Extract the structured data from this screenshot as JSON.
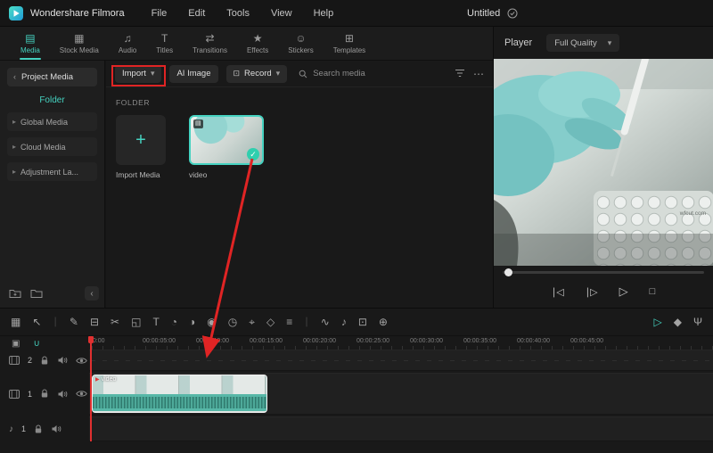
{
  "colors": {
    "accent": "#45d2c0",
    "annotation_red": "#e02424"
  },
  "titlebar": {
    "app_name": "Wondershare Filmora",
    "menus": [
      {
        "name": "menu-file",
        "label": "File"
      },
      {
        "name": "menu-edit",
        "label": "Edit"
      },
      {
        "name": "menu-tools",
        "label": "Tools"
      },
      {
        "name": "menu-view",
        "label": "View"
      },
      {
        "name": "menu-help",
        "label": "Help"
      }
    ],
    "project_name": "Untitled"
  },
  "tabs": [
    {
      "name": "tab-media",
      "label": "Media",
      "glyph": "▤",
      "active": true
    },
    {
      "name": "tab-stock-media",
      "label": "Stock Media",
      "glyph": "▦"
    },
    {
      "name": "tab-audio",
      "label": "Audio",
      "glyph": "♫"
    },
    {
      "name": "tab-titles",
      "label": "Titles",
      "glyph": "T"
    },
    {
      "name": "tab-transitions",
      "label": "Transitions",
      "glyph": "⇄"
    },
    {
      "name": "tab-effects",
      "label": "Effects",
      "glyph": "★"
    },
    {
      "name": "tab-stickers",
      "label": "Stickers",
      "glyph": "☺"
    },
    {
      "name": "tab-templates",
      "label": "Templates",
      "glyph": "⊞"
    }
  ],
  "sidebar": {
    "back_label": "Project Media",
    "selected_folder": "Folder",
    "groups": [
      {
        "name": "sidebar-item-global-media",
        "label": "Global Media"
      },
      {
        "name": "sidebar-item-cloud-media",
        "label": "Cloud Media"
      },
      {
        "name": "sidebar-item-adjustment-layer",
        "label": "Adjustment La..."
      }
    ]
  },
  "media_panel": {
    "toolbar": {
      "import_label": "Import",
      "ai_image_label": "AI Image",
      "record_label": "Record",
      "search_placeholder": "Search media"
    },
    "section_label": "FOLDER",
    "import_tile_label": "Import Media",
    "video_tile_label": "video"
  },
  "player": {
    "title": "Player",
    "quality": "Full Quality",
    "watermark": "wfcut.com",
    "transport": [
      {
        "name": "previous-frame-button",
        "glyph": "∣◁"
      },
      {
        "name": "next-frame-button",
        "glyph": "∣▷"
      },
      {
        "name": "play-button",
        "glyph": "▷",
        "big": true
      },
      {
        "name": "stop-button",
        "glyph": "□"
      }
    ]
  },
  "timeline": {
    "tools_left": [
      {
        "name": "media-browser-icon",
        "glyph": "▦"
      },
      {
        "name": "select-tool-icon",
        "glyph": "↖"
      },
      {
        "name": "toolbar-divider",
        "glyph": "∣",
        "dim": true
      },
      {
        "name": "ripple-edit-icon",
        "glyph": "✎"
      },
      {
        "name": "delete-icon",
        "glyph": "⊟"
      },
      {
        "name": "split-icon",
        "glyph": "✂"
      },
      {
        "name": "crop-icon",
        "glyph": "◱"
      },
      {
        "name": "text-tool-icon",
        "glyph": "T"
      },
      {
        "name": "speed-icon",
        "glyph": "◔"
      },
      {
        "name": "color-icon",
        "glyph": "◑"
      },
      {
        "name": "mask-icon",
        "glyph": "◉"
      },
      {
        "name": "timer-icon",
        "glyph": "◷"
      },
      {
        "name": "motion-tracking-icon",
        "glyph": "⌖"
      },
      {
        "name": "keyframe-icon",
        "glyph": "◇"
      },
      {
        "name": "adjust-icon",
        "glyph": "≡"
      },
      {
        "name": "toolbar-divider",
        "glyph": "∣",
        "dim": true
      },
      {
        "name": "audio-wave-icon",
        "glyph": "∿"
      },
      {
        "name": "audio-note-icon",
        "glyph": "♪"
      },
      {
        "name": "snapshot-icon",
        "glyph": "⊡"
      },
      {
        "name": "marker-icon",
        "glyph": "⊕"
      }
    ],
    "tools_right": [
      {
        "name": "render-preview-icon",
        "glyph": "▷",
        "accent": true
      },
      {
        "name": "quality-badge-icon",
        "glyph": "◆"
      },
      {
        "name": "voiceover-mic-icon",
        "glyph": "Ψ"
      }
    ],
    "header_icons": [
      {
        "name": "manage-tracks-icon",
        "glyph": "▣"
      },
      {
        "name": "snap-icon",
        "glyph": "∪",
        "accent": true
      }
    ],
    "ruler": [
      {
        "label": "00:00"
      },
      {
        "label": "00:00:05:00"
      },
      {
        "label": "00:00:10:00"
      },
      {
        "label": "00:00:15:00"
      },
      {
        "label": "00:00:20:00"
      },
      {
        "label": "00:00:25:00"
      },
      {
        "label": "00:00:30:00"
      },
      {
        "label": "00:00:35:00"
      },
      {
        "label": "00:00:40:00"
      },
      {
        "label": "00:00:45:00"
      }
    ],
    "tracks": [
      {
        "number": "2"
      },
      {
        "number": "1"
      },
      {
        "number": "1"
      }
    ],
    "clip_label": "video"
  }
}
